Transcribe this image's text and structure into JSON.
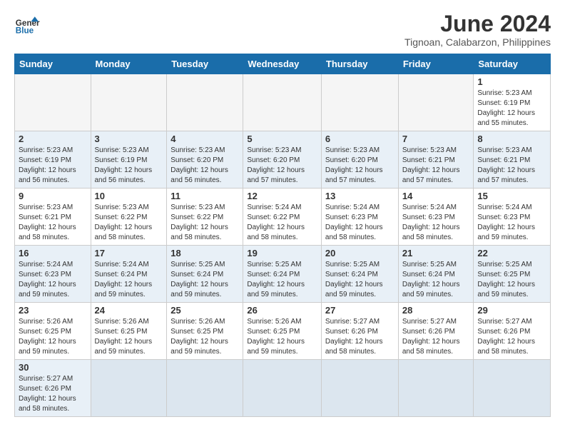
{
  "header": {
    "logo_general": "General",
    "logo_blue": "Blue",
    "month_title": "June 2024",
    "subtitle": "Tignoan, Calabarzon, Philippines"
  },
  "days_of_week": [
    "Sunday",
    "Monday",
    "Tuesday",
    "Wednesday",
    "Thursday",
    "Friday",
    "Saturday"
  ],
  "weeks": [
    {
      "days": [
        {
          "num": "",
          "info": ""
        },
        {
          "num": "",
          "info": ""
        },
        {
          "num": "",
          "info": ""
        },
        {
          "num": "",
          "info": ""
        },
        {
          "num": "",
          "info": ""
        },
        {
          "num": "",
          "info": ""
        },
        {
          "num": "1",
          "info": "Sunrise: 5:23 AM\nSunset: 6:19 PM\nDaylight: 12 hours and 55 minutes."
        }
      ]
    },
    {
      "days": [
        {
          "num": "2",
          "info": "Sunrise: 5:23 AM\nSunset: 6:19 PM\nDaylight: 12 hours and 56 minutes."
        },
        {
          "num": "3",
          "info": "Sunrise: 5:23 AM\nSunset: 6:19 PM\nDaylight: 12 hours and 56 minutes."
        },
        {
          "num": "4",
          "info": "Sunrise: 5:23 AM\nSunset: 6:20 PM\nDaylight: 12 hours and 56 minutes."
        },
        {
          "num": "5",
          "info": "Sunrise: 5:23 AM\nSunset: 6:20 PM\nDaylight: 12 hours and 57 minutes."
        },
        {
          "num": "6",
          "info": "Sunrise: 5:23 AM\nSunset: 6:20 PM\nDaylight: 12 hours and 57 minutes."
        },
        {
          "num": "7",
          "info": "Sunrise: 5:23 AM\nSunset: 6:21 PM\nDaylight: 12 hours and 57 minutes."
        },
        {
          "num": "8",
          "info": "Sunrise: 5:23 AM\nSunset: 6:21 PM\nDaylight: 12 hours and 57 minutes."
        }
      ]
    },
    {
      "days": [
        {
          "num": "9",
          "info": "Sunrise: 5:23 AM\nSunset: 6:21 PM\nDaylight: 12 hours and 58 minutes."
        },
        {
          "num": "10",
          "info": "Sunrise: 5:23 AM\nSunset: 6:22 PM\nDaylight: 12 hours and 58 minutes."
        },
        {
          "num": "11",
          "info": "Sunrise: 5:23 AM\nSunset: 6:22 PM\nDaylight: 12 hours and 58 minutes."
        },
        {
          "num": "12",
          "info": "Sunrise: 5:24 AM\nSunset: 6:22 PM\nDaylight: 12 hours and 58 minutes."
        },
        {
          "num": "13",
          "info": "Sunrise: 5:24 AM\nSunset: 6:23 PM\nDaylight: 12 hours and 58 minutes."
        },
        {
          "num": "14",
          "info": "Sunrise: 5:24 AM\nSunset: 6:23 PM\nDaylight: 12 hours and 58 minutes."
        },
        {
          "num": "15",
          "info": "Sunrise: 5:24 AM\nSunset: 6:23 PM\nDaylight: 12 hours and 59 minutes."
        }
      ]
    },
    {
      "days": [
        {
          "num": "16",
          "info": "Sunrise: 5:24 AM\nSunset: 6:23 PM\nDaylight: 12 hours and 59 minutes."
        },
        {
          "num": "17",
          "info": "Sunrise: 5:24 AM\nSunset: 6:24 PM\nDaylight: 12 hours and 59 minutes."
        },
        {
          "num": "18",
          "info": "Sunrise: 5:25 AM\nSunset: 6:24 PM\nDaylight: 12 hours and 59 minutes."
        },
        {
          "num": "19",
          "info": "Sunrise: 5:25 AM\nSunset: 6:24 PM\nDaylight: 12 hours and 59 minutes."
        },
        {
          "num": "20",
          "info": "Sunrise: 5:25 AM\nSunset: 6:24 PM\nDaylight: 12 hours and 59 minutes."
        },
        {
          "num": "21",
          "info": "Sunrise: 5:25 AM\nSunset: 6:24 PM\nDaylight: 12 hours and 59 minutes."
        },
        {
          "num": "22",
          "info": "Sunrise: 5:25 AM\nSunset: 6:25 PM\nDaylight: 12 hours and 59 minutes."
        }
      ]
    },
    {
      "days": [
        {
          "num": "23",
          "info": "Sunrise: 5:26 AM\nSunset: 6:25 PM\nDaylight: 12 hours and 59 minutes."
        },
        {
          "num": "24",
          "info": "Sunrise: 5:26 AM\nSunset: 6:25 PM\nDaylight: 12 hours and 59 minutes."
        },
        {
          "num": "25",
          "info": "Sunrise: 5:26 AM\nSunset: 6:25 PM\nDaylight: 12 hours and 59 minutes."
        },
        {
          "num": "26",
          "info": "Sunrise: 5:26 AM\nSunset: 6:25 PM\nDaylight: 12 hours and 59 minutes."
        },
        {
          "num": "27",
          "info": "Sunrise: 5:27 AM\nSunset: 6:26 PM\nDaylight: 12 hours and 58 minutes."
        },
        {
          "num": "28",
          "info": "Sunrise: 5:27 AM\nSunset: 6:26 PM\nDaylight: 12 hours and 58 minutes."
        },
        {
          "num": "29",
          "info": "Sunrise: 5:27 AM\nSunset: 6:26 PM\nDaylight: 12 hours and 58 minutes."
        }
      ]
    },
    {
      "days": [
        {
          "num": "30",
          "info": "Sunrise: 5:27 AM\nSunset: 6:26 PM\nDaylight: 12 hours and 58 minutes."
        },
        {
          "num": "",
          "info": ""
        },
        {
          "num": "",
          "info": ""
        },
        {
          "num": "",
          "info": ""
        },
        {
          "num": "",
          "info": ""
        },
        {
          "num": "",
          "info": ""
        },
        {
          "num": "",
          "info": ""
        }
      ]
    }
  ]
}
